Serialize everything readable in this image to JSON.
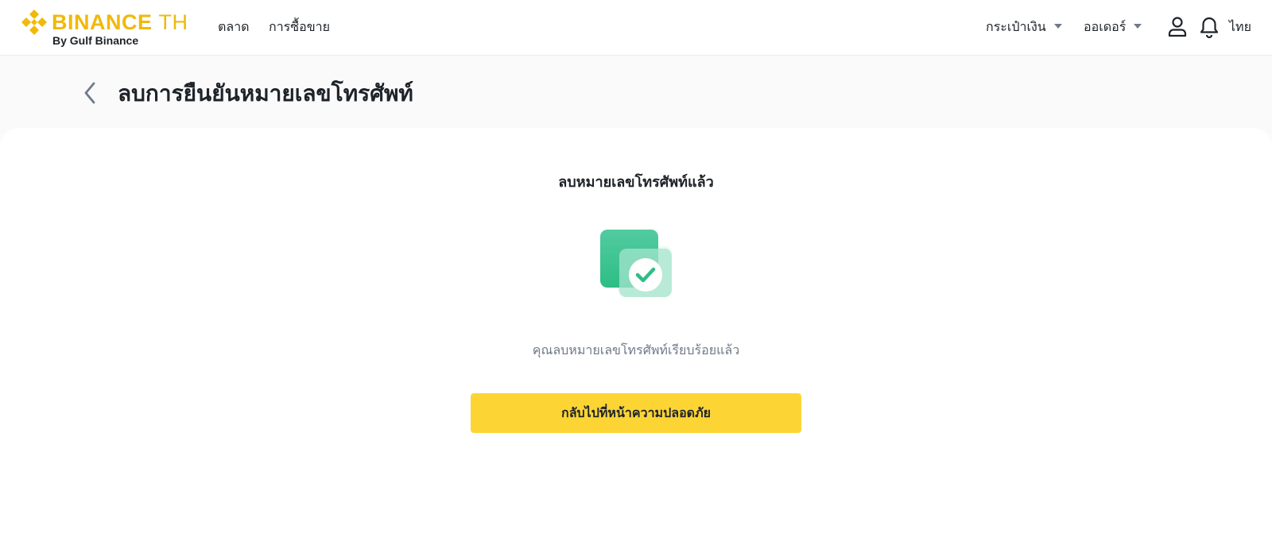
{
  "header": {
    "brand": {
      "name": "BINANCE",
      "region": "TH",
      "subtitle": "By Gulf Binance",
      "color": "#F0B90B"
    },
    "nav": [
      {
        "label": "ตลาด"
      },
      {
        "label": "การซื้อขาย"
      }
    ],
    "wallet_menu": {
      "label": "กระเป๋าเงิน",
      "icon": "chevron-down-icon"
    },
    "orders_menu": {
      "label": "ออเดอร์",
      "icon": "chevron-down-icon"
    },
    "user_icon": "user-icon",
    "notification_icon": "bell-icon",
    "language": "ไทย"
  },
  "page": {
    "back_icon": "chevron-left-icon",
    "title": "ลบการยืนยันหมายเลขโทรศัพท์"
  },
  "result": {
    "title": "ลบหมายเลขโทรศัพท์แล้ว",
    "illustration": "success-check-icon",
    "message": "คุณลบหมายเลขโทรศัพท์เรียบร้อยแล้ว",
    "button_label": "กลับไปที่หน้าความปลอดภัย"
  },
  "colors": {
    "accent_yellow": "#FCD535",
    "brand_yellow": "#F0B90B",
    "success_green": "#2EBD85",
    "text_primary": "#1E2329",
    "text_secondary": "#707A8A",
    "subheader_bg": "#FAFAFA"
  }
}
